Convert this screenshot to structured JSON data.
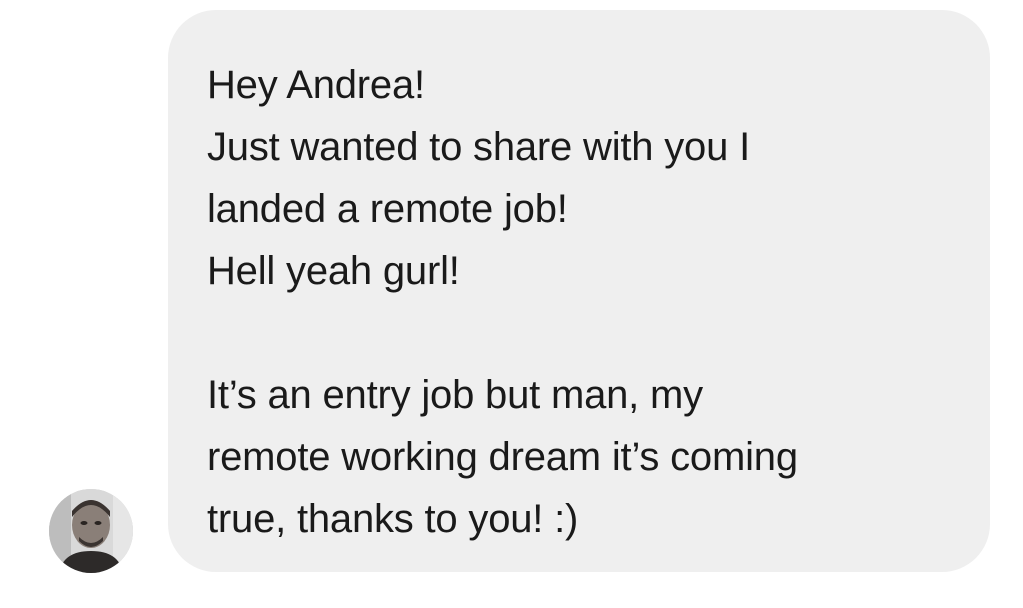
{
  "message": {
    "lines_block_1": [
      "Hey Andrea!",
      "Just wanted to share with you I",
      "landed a remote job!",
      "Hell yeah gurl!"
    ],
    "lines_block_2": [
      "It’s an entry job but man, my",
      "remote working dream it’s coming",
      "true, thanks to you! :)"
    ]
  },
  "sender": {
    "avatar_icon": "user-photo-avatar"
  },
  "colors": {
    "bubble_bg": "#efefef",
    "text": "#1a1a1a",
    "page_bg": "#ffffff"
  }
}
